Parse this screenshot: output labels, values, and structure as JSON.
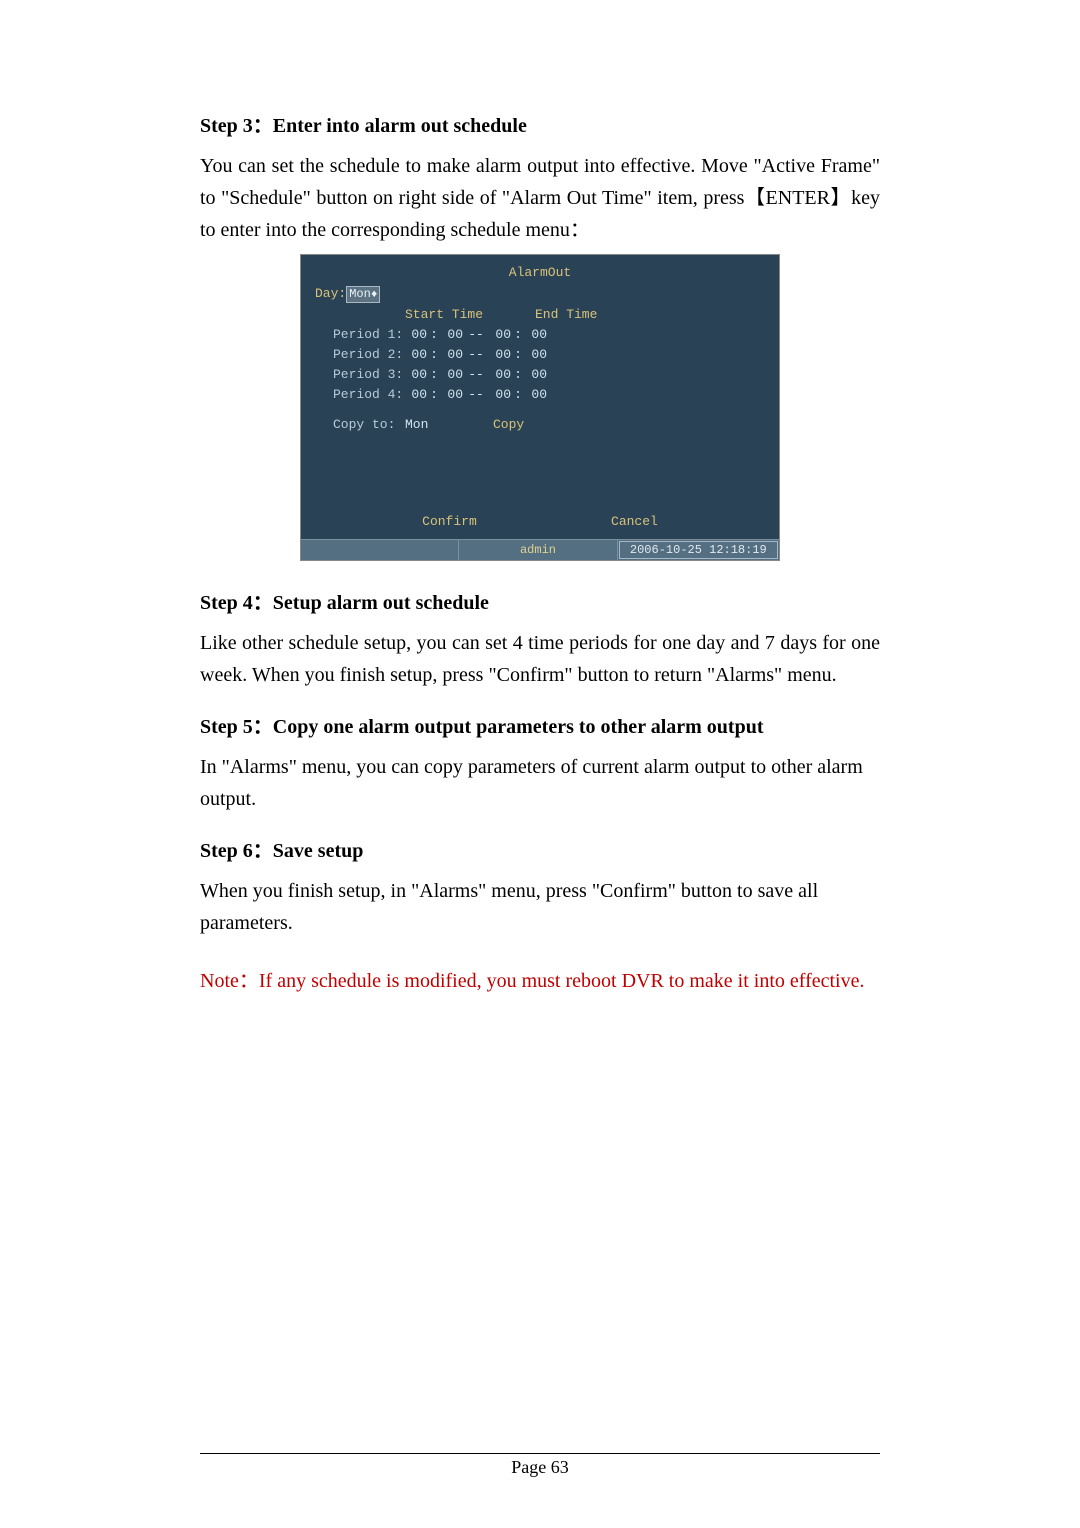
{
  "step3": {
    "heading": "Step 3：Enter into alarm out schedule",
    "body": "You can set the schedule to make alarm output into effective. Move \"Active Frame\" to \"Schedule\" button on right side of \"Alarm Out Time\" item, press【ENTER】key to enter into the corresponding schedule menu："
  },
  "dvr": {
    "title": "AlarmOut",
    "day_label": "Day:",
    "day_value": "Mon",
    "header_start": "Start Time",
    "header_end": "End Time",
    "periods": [
      {
        "label": "Period 1:",
        "sh": "00",
        "sm": "00",
        "eh": "00",
        "em": "00"
      },
      {
        "label": "Period 2:",
        "sh": "00",
        "sm": "00",
        "eh": "00",
        "em": "00"
      },
      {
        "label": "Period 3:",
        "sh": "00",
        "sm": "00",
        "eh": "00",
        "em": "00"
      },
      {
        "label": "Period 4:",
        "sh": "00",
        "sm": "00",
        "eh": "00",
        "em": "00"
      }
    ],
    "copy_label": "Copy to:",
    "copy_value": "Mon",
    "copy_btn": "Copy",
    "confirm": "Confirm",
    "cancel": "Cancel",
    "status_user": "admin",
    "status_time": "2006-10-25 12:18:19"
  },
  "step4": {
    "heading": "Step 4：Setup alarm out schedule",
    "body": "Like other schedule setup, you can set 4 time periods for one day and 7 days for one week. When you finish setup, press \"Confirm\" button to return \"Alarms\" menu."
  },
  "step5": {
    "heading": "Step 5：Copy one alarm output parameters to other alarm output",
    "body": "In \"Alarms\" menu, you can copy parameters of current alarm output to other alarm output."
  },
  "step6": {
    "heading": "Step 6：Save setup",
    "body": "When you finish setup, in \"Alarms\" menu, press \"Confirm\" button to save all parameters."
  },
  "note": "Note：If any schedule is modified, you must reboot DVR to make it into effective.",
  "footer": "Page 63"
}
